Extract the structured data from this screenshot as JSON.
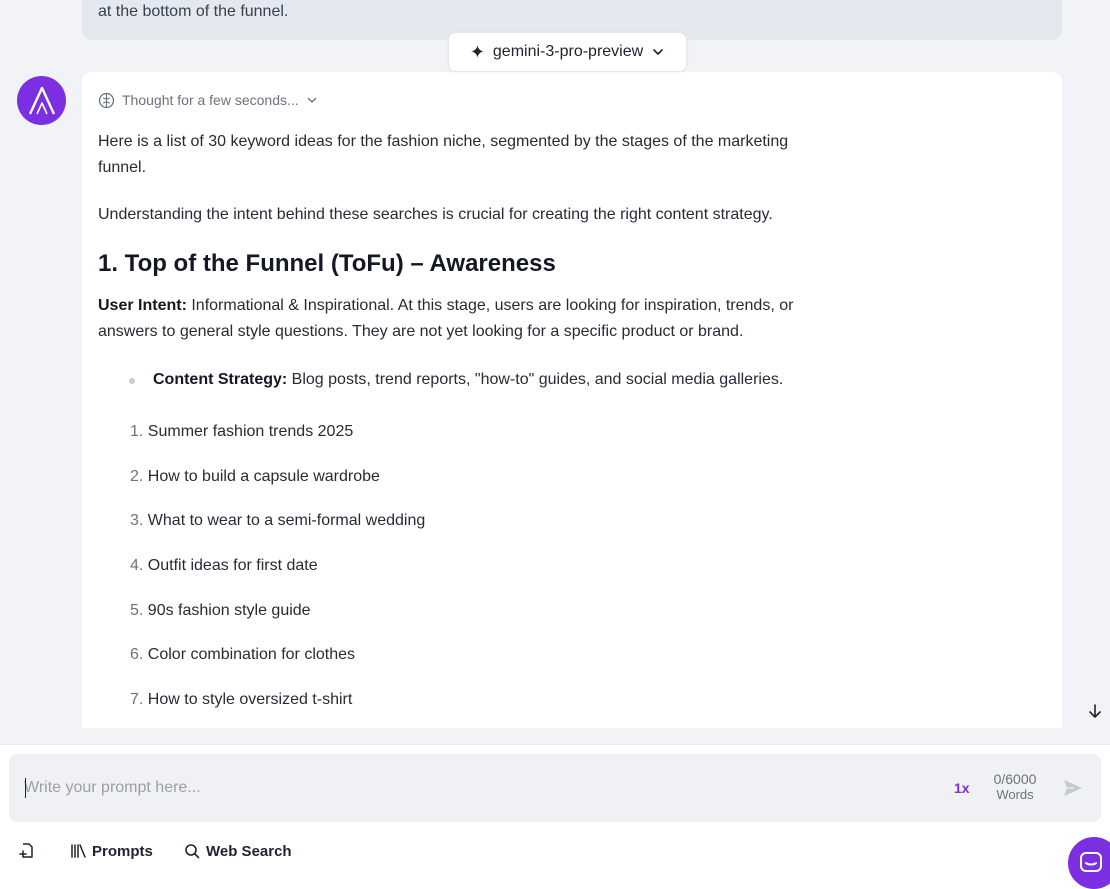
{
  "previous_message": {
    "tail_text": "at the bottom of the funnel."
  },
  "model_selector": {
    "label": "gemini-3-pro-preview"
  },
  "response": {
    "thought_label": "Thought for a few seconds...",
    "intro": "Here is a list of 30 keyword ideas for the fashion niche, segmented by the stages of the marketing funnel.",
    "understanding": "Understanding the intent behind these searches is crucial for creating the right content strategy.",
    "section_title": "1. Top of the Funnel (ToFu) – Awareness",
    "intent_label": "User Intent:",
    "intent_text": " Informational & Inspirational. At this stage, users are looking for inspiration, trends, or answers to general style questions. They are not yet looking for a specific product or brand.",
    "strategy_label": "Content Strategy:",
    "strategy_text": " Blog posts, trend reports, \"how-to\" guides, and social media galleries.",
    "keywords": [
      {
        "num": "1.",
        "text": "Summer fashion trends 2025"
      },
      {
        "num": "2.",
        "text": "How to build a capsule wardrobe"
      },
      {
        "num": "3.",
        "text": "What to wear to a semi-formal wedding"
      },
      {
        "num": "4.",
        "text": "Outfit ideas for first date"
      },
      {
        "num": "5.",
        "text": "90s fashion style guide"
      },
      {
        "num": "6.",
        "text": "Color combination for clothes"
      },
      {
        "num": "7.",
        "text": "How to style oversized t-shirt"
      }
    ]
  },
  "composer": {
    "placeholder": "Write your prompt here...",
    "speed": "1x",
    "word_count": "0/6000",
    "word_label": "Words",
    "toolbar": {
      "prompts": "Prompts",
      "web_search": "Web Search"
    }
  },
  "colors": {
    "accent": "#7b2fe0",
    "background": "#f1f3f7",
    "card": "#ffffff"
  },
  "icons": [
    "sparkle-icon",
    "chevron-down-icon",
    "brain-icon",
    "arrow-down-icon",
    "send-icon",
    "attach-file-icon",
    "library-icon",
    "search-icon",
    "chat-icon"
  ]
}
